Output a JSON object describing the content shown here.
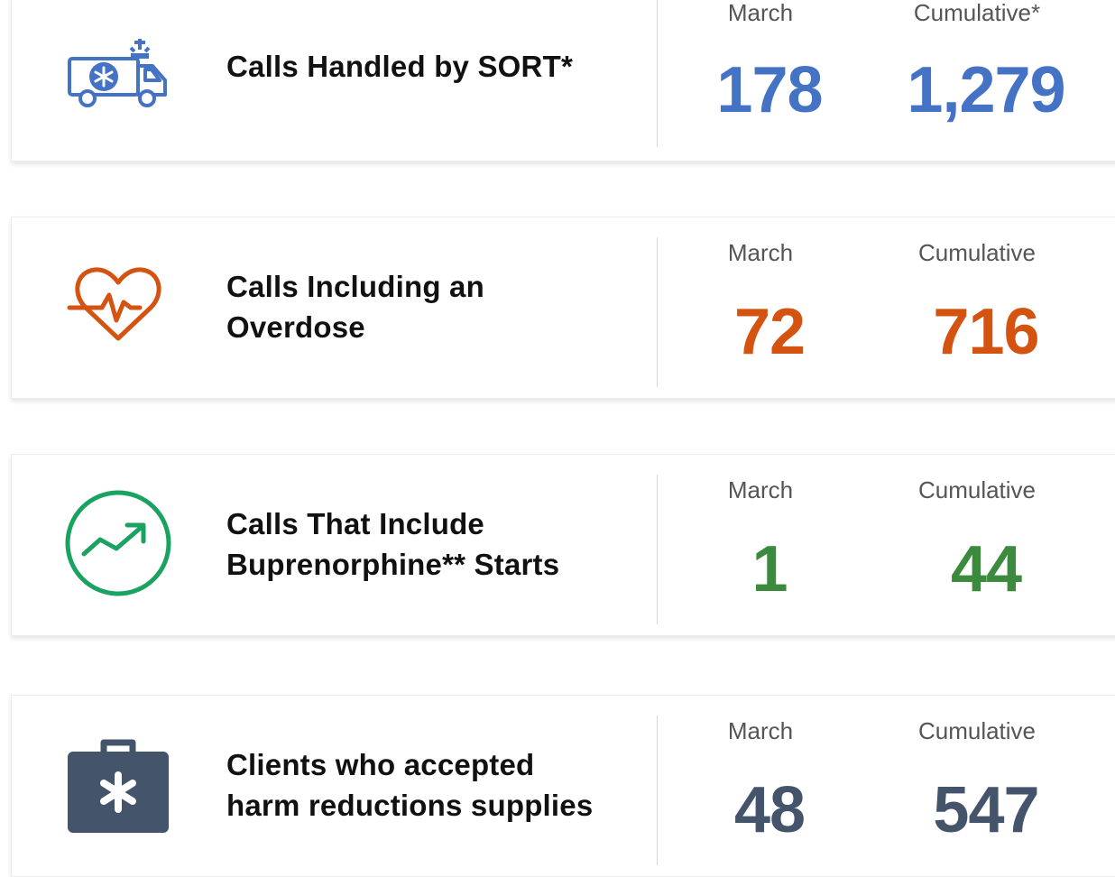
{
  "colors": {
    "blue": "#4472c4",
    "orange": "#d45311",
    "green": "#3b8a3e",
    "slate": "#44546a",
    "icon_green": "#1aa260"
  },
  "cards": [
    {
      "icon": "ambulance-icon",
      "label_lines": [
        "Calls Handled by SORT*"
      ],
      "month_label": "March",
      "cumulative_label": "Cumulative*",
      "month_value": "178",
      "cumulative_value": "1,279"
    },
    {
      "icon": "heartbeat-icon",
      "label_lines": [
        "Calls Including an",
        "Overdose"
      ],
      "month_label": "March",
      "cumulative_label": "Cumulative",
      "month_value": "72",
      "cumulative_value": "716"
    },
    {
      "icon": "trending-up-icon",
      "label_lines": [
        "Calls That Include",
        "Buprenorphine** Starts"
      ],
      "month_label": "March",
      "cumulative_label": "Cumulative",
      "month_value": "1",
      "cumulative_value": "44"
    },
    {
      "icon": "medical-kit-icon",
      "label_lines": [
        "Clients who accepted",
        "harm reductions supplies"
      ],
      "month_label": "March",
      "cumulative_label": "Cumulative",
      "month_value": "48",
      "cumulative_value": "547"
    }
  ]
}
